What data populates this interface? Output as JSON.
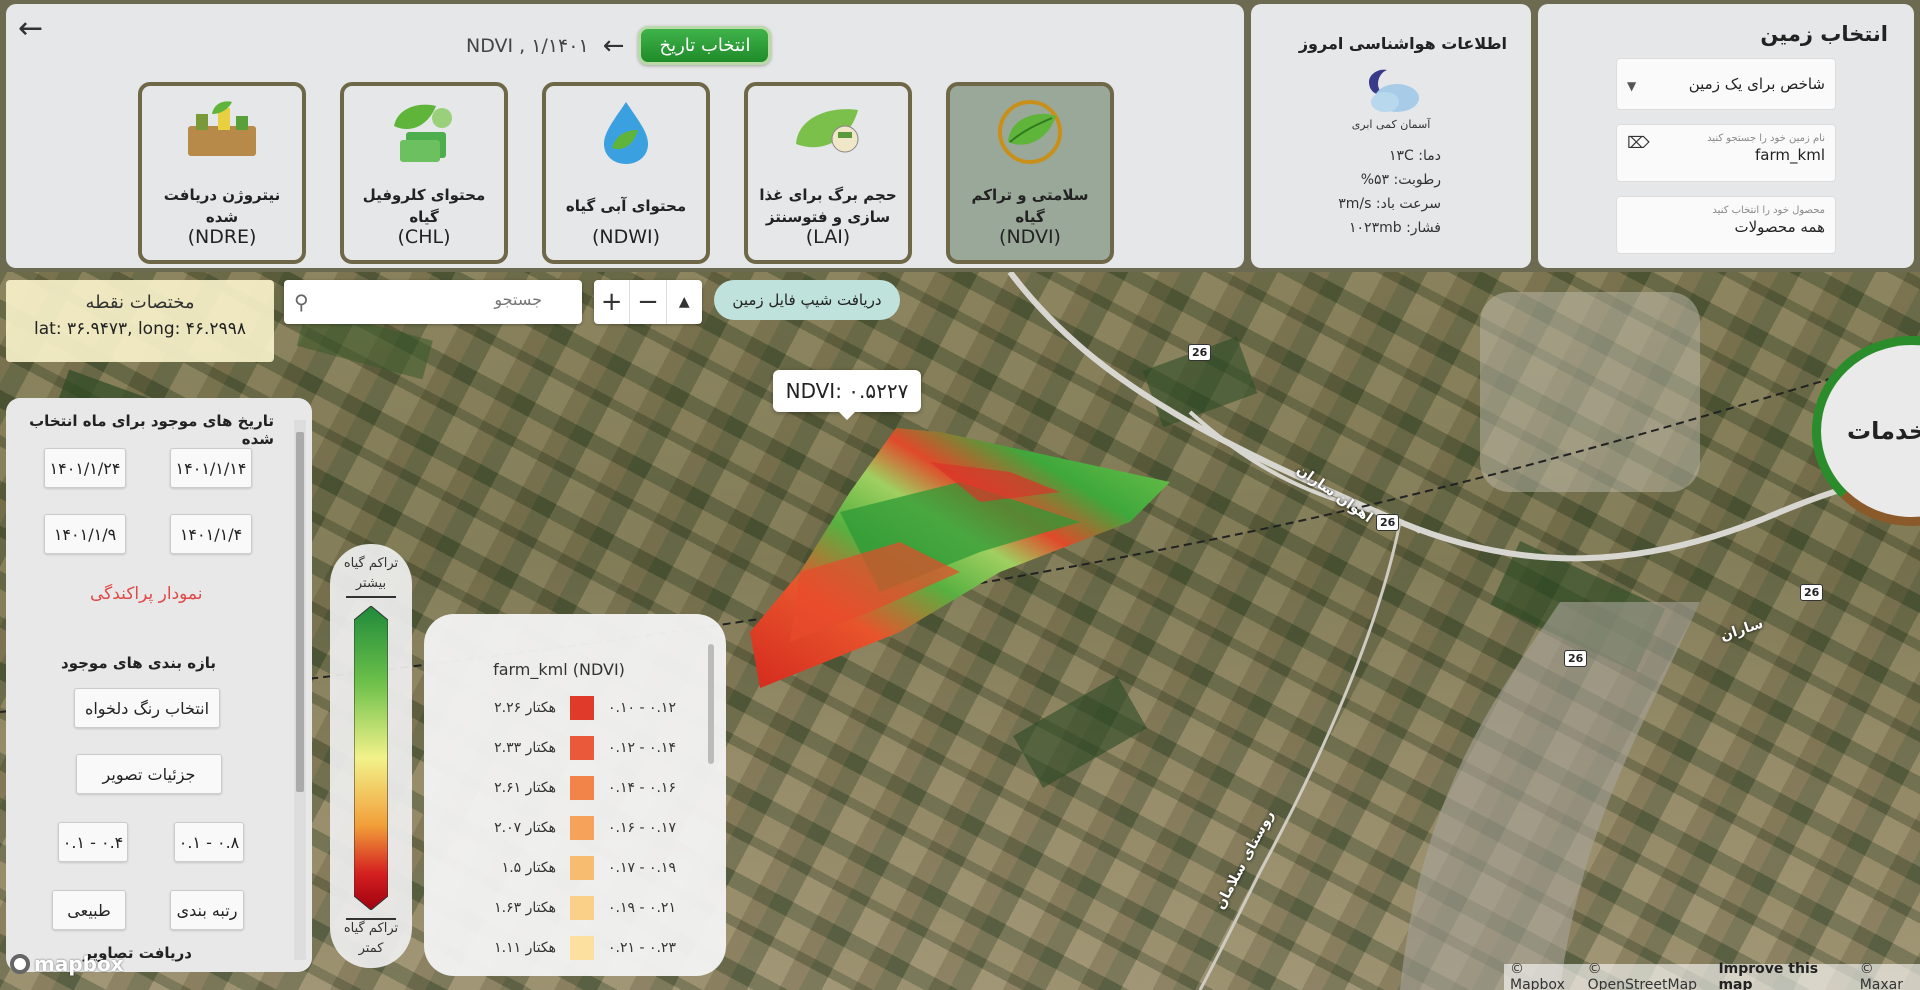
{
  "header": {
    "date_button": "انتخاب تاریخ",
    "date_text": "NDVI , ۱/۱۴۰۱"
  },
  "indices": [
    {
      "title": "سلامتی و تراکم گیاه",
      "code": "(NDVI)",
      "active": true
    },
    {
      "title": "حجم برگ برای غذا سازی و فتوسنتز",
      "code": "(LAI)",
      "active": false
    },
    {
      "title": "محتوای آبی گیاه",
      "code": "(NDWI)",
      "active": false
    },
    {
      "title": "محتوای کلروفیل گیاه",
      "code": "(CHL)",
      "active": false
    },
    {
      "title": "نیتروژن دریافت شده",
      "code": "(NDRE)",
      "active": false
    }
  ],
  "weather": {
    "title": "اطلاعات هواشناسی امروز",
    "description": "آسمان کمی ابری",
    "temperature": "دما: ۱۳C",
    "humidity": "رطوبت: ۵۳%",
    "wind": "سرعت باد: ۳m/s",
    "pressure": "فشار: ۱۰۲۳mb"
  },
  "land": {
    "title": "انتخاب زمین",
    "index_select": "شاخص برای یک زمین",
    "search_label": "نام زمین خود را جستجو کنید",
    "search_value": "farm_kml",
    "crop_label": "محصول خود را انتخاب کنید",
    "crop_value": "همه محصولات"
  },
  "point": {
    "title": "مختصات نقطه",
    "coords": "lat: ۳۶.۹۴۷۳, long: ۴۶.۲۹۹۸"
  },
  "map": {
    "search_placeholder": "جستجو",
    "shapefile_button": "دریافت شیپ فایل زمین",
    "tooltip": "NDVI: ۰.۵۲۲۷",
    "services": "خدمات",
    "road_number": "26",
    "labels": [
      "اهوان ساران",
      "ساران",
      "روستای سلامان"
    ],
    "mapbox": "mapbox",
    "attribution": [
      "© Mapbox",
      "© OpenStreetMap",
      "Improve this map",
      "© Maxar"
    ]
  },
  "dates_panel": {
    "title": "تاریخ های موجود برای ماه انتخاب شده",
    "dates": [
      "۱۴۰۱/۱/۱۴",
      "۱۴۰۱/۱/۲۴",
      "۱۴۰۱/۱/۴",
      "۱۴۰۱/۱/۹"
    ],
    "scatter": "نمودار پراکندگی",
    "ranges_heading": "بازه بندی های موجود",
    "custom_color": "انتخاب رنگ دلخواه",
    "image_details": "جزئیات تصویر",
    "range_a": "۰.۱ - ۰.۸",
    "range_b": "۰.۱ - ۰.۴",
    "ranking": "رتبه بندی",
    "natural": "طبیعی",
    "download": "دریافت تصاویر"
  },
  "gradient_legend": {
    "top": [
      "تراکم گیاه",
      "بیشتر"
    ],
    "bottom": [
      "تراکم گیاه",
      "کمتر"
    ],
    "colors": [
      "#1f8a3a",
      "#6cc04a",
      "#f2f28a",
      "#f2a03a",
      "#d42020",
      "#a00010"
    ]
  },
  "class_legend": {
    "title": "farm_kml (NDVI)",
    "rows": [
      {
        "range": "۰.۱۰ - ۰.۱۲",
        "area": "هکتار ۲.۲۶",
        "color": "#e03a2a"
      },
      {
        "range": "۰.۱۲ - ۰.۱۴",
        "area": "هکتار ۲.۳۳",
        "color": "#ea5a3a"
      },
      {
        "range": "۰.۱۴ - ۰.۱۶",
        "area": "هکتار ۲.۶۱",
        "color": "#f2844a"
      },
      {
        "range": "۰.۱۶ - ۰.۱۷",
        "area": "هکتار ۲.۰۷",
        "color": "#f6a25a"
      },
      {
        "range": "۰.۱۷ - ۰.۱۹",
        "area": "هکتار ۱.۵",
        "color": "#f8bc70"
      },
      {
        "range": "۰.۱۹ - ۰.۲۱",
        "area": "هکتار ۱.۶۳",
        "color": "#fad088"
      },
      {
        "range": "۰.۲۱ - ۰.۲۳",
        "area": "هکتار ۱.۱۱",
        "color": "#fbe0a0"
      }
    ]
  }
}
